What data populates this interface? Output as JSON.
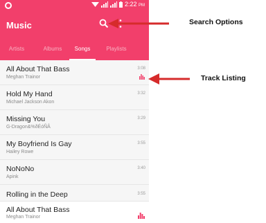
{
  "status_bar": {
    "time": "2:22",
    "ampm": "PM"
  },
  "app": {
    "title": "Music",
    "accent_color": "#f23f6b"
  },
  "tabs": [
    {
      "label": "Artists",
      "active": false
    },
    {
      "label": "Albums",
      "active": false
    },
    {
      "label": "Songs",
      "active": true
    },
    {
      "label": "Playlists",
      "active": false
    }
  ],
  "tracks": [
    {
      "title": "All About That Bass",
      "artist": "Meghan Trainor",
      "duration": "3:08",
      "playing": true
    },
    {
      "title": "Hold My Hand",
      "artist": "Michael Jackson  Akon",
      "duration": "3:32",
      "playing": false
    },
    {
      "title": "Missing You",
      "artist": "G-Dragon&%ðÉóÑÂ",
      "duration": "3:29",
      "playing": false
    },
    {
      "title": "My Boyfriend Is Gay",
      "artist": "Hailey Rowe",
      "duration": "3:55",
      "playing": false
    },
    {
      "title": "NoNoNo",
      "artist": "Apink",
      "duration": "3:40",
      "playing": false
    },
    {
      "title": "Rolling in the Deep",
      "artist": "",
      "duration": "3:55",
      "playing": false
    }
  ],
  "now_playing": {
    "title": "All About That Bass",
    "artist": "Meghan Trainor"
  },
  "annotations": {
    "search_options": "Search Options",
    "track_listing": "Track Listing",
    "arrow_color": "#d62b2b"
  },
  "icons": [
    "wifi-icon",
    "signal-icon",
    "battery-icon",
    "search-icon",
    "overflow-menu-icon",
    "equalizer-icon"
  ]
}
